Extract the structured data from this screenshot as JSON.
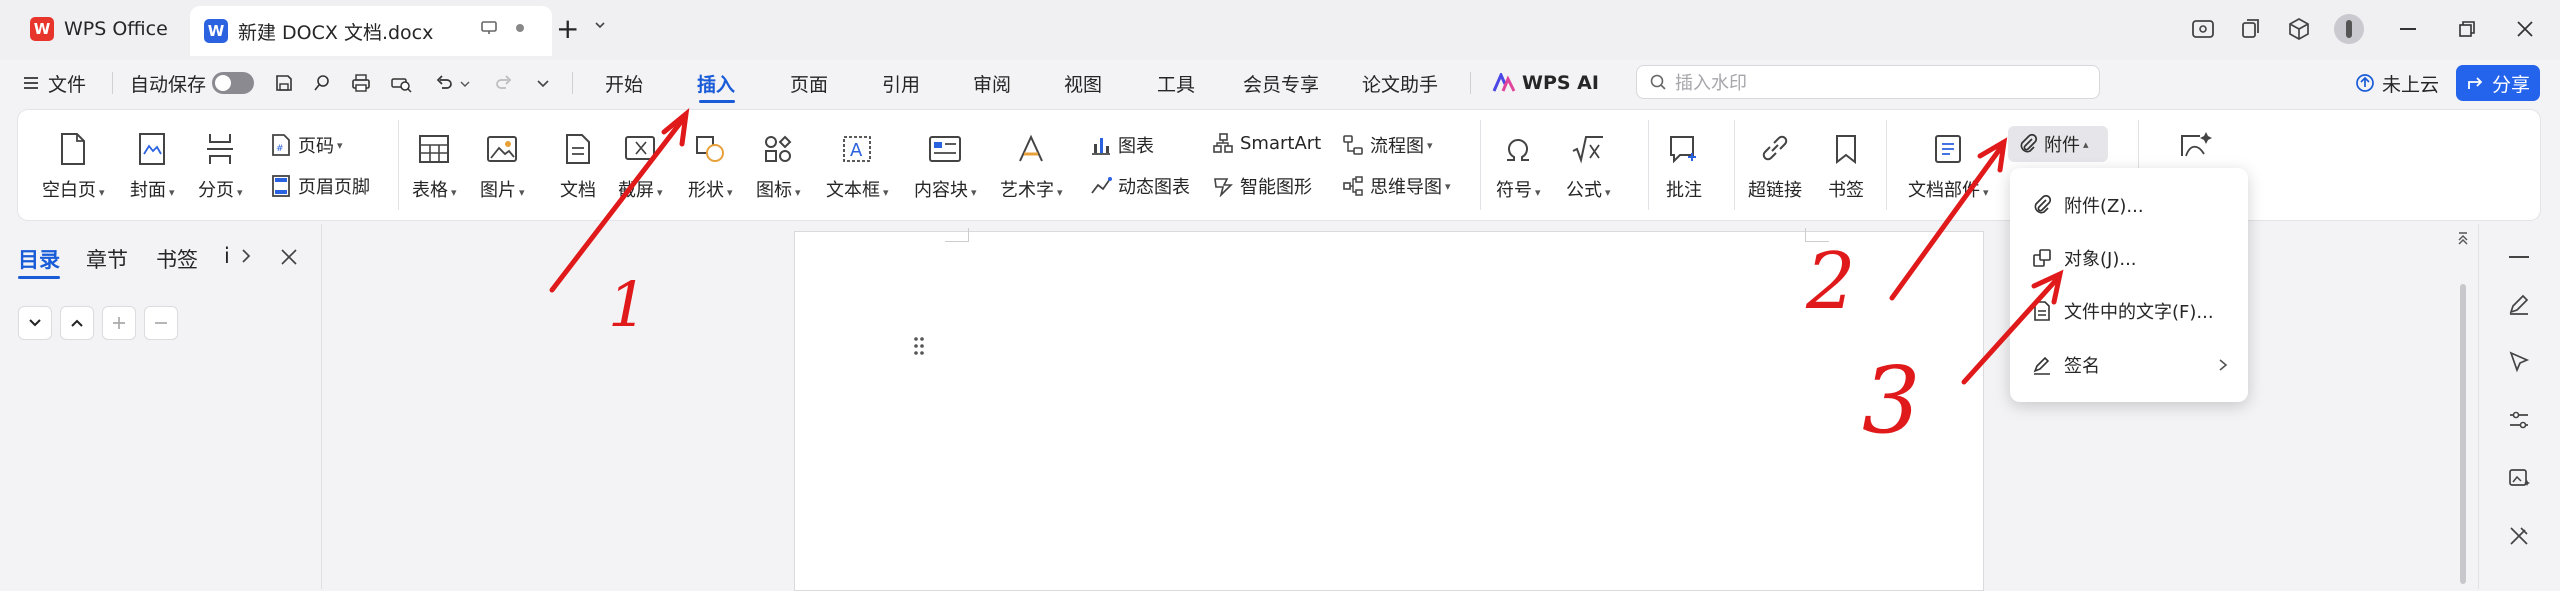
{
  "titlebar": {
    "wps_tab": "WPS Office",
    "doc_tab": "新建 DOCX 文档.docx",
    "new_tab": "+"
  },
  "menubar": {
    "file": "文件",
    "autosave": "自动保存",
    "tabs": [
      "开始",
      "插入",
      "页面",
      "引用",
      "审阅",
      "视图",
      "工具",
      "会员专享",
      "论文助手"
    ],
    "wps_ai": "WPS AI",
    "search_placeholder": "插入水印",
    "cloud": "未上云",
    "share": "分享"
  },
  "ribbon": {
    "blank_page": "空白页",
    "cover": "封面",
    "page_break": "分页",
    "page_number": "页码",
    "header_footer": "页眉页脚",
    "table": "表格",
    "picture": "图片",
    "document": "文档",
    "screenshot": "截屏",
    "shape": "形状",
    "icon": "图标",
    "textbox": "文本框",
    "content_block": "内容块",
    "wordart": "艺术字",
    "chart": "图表",
    "dynamic_chart": "动态图表",
    "smartart": "SmartArt",
    "smart_shape": "智能图形",
    "flowchart": "流程图",
    "mindmap": "思维导图",
    "symbol": "符号",
    "formula": "公式",
    "comment": "批注",
    "hyperlink": "超链接",
    "bookmark": "书签",
    "doc_parts": "文档部件",
    "attachment": "附件"
  },
  "leftpanel": {
    "tabs": [
      "目录",
      "章节",
      "书签",
      "i"
    ]
  },
  "dropdown": {
    "items": [
      "附件(Z)...",
      "对象(J)...",
      "文件中的文字(F)...",
      "签名"
    ]
  },
  "annotations": [
    "1",
    "2",
    "3"
  ],
  "colors": {
    "accent": "#1a5cd8",
    "wps_red": "#e8352b",
    "word_blue": "#2b62e0",
    "annotation_red": "#e0191b",
    "share_bg": "#2463eb"
  }
}
